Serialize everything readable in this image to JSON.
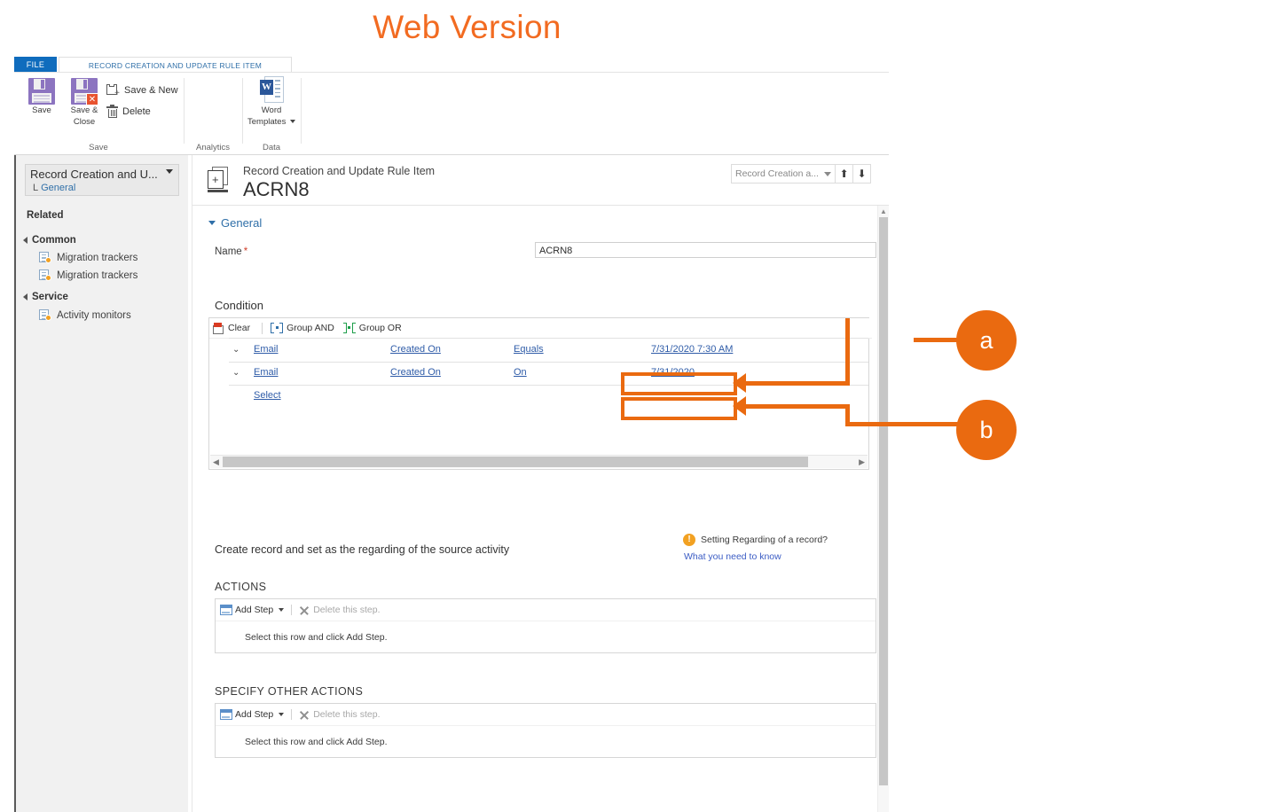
{
  "slide": {
    "title": "Web Version"
  },
  "ribbon": {
    "tabs": [
      {
        "label": "FILE",
        "name": "tab-file"
      },
      {
        "label": "RECORD CREATION AND UPDATE RULE ITEM",
        "name": "tab-record-creation-and-update-rule-item"
      }
    ],
    "buttons": {
      "save": "Save",
      "save_close_line1": "Save &",
      "save_close_line2": "Close",
      "save_new": "Save & New",
      "delete": "Delete",
      "word_templates_line1": "Word",
      "word_templates_line2": "Templates"
    },
    "group_labels": {
      "save": "Save",
      "analytics": "Analytics",
      "data": "Data"
    }
  },
  "sidebar": {
    "selector": {
      "title": "Record Creation and U...",
      "sub_prefix": "L",
      "sub_label": "General"
    },
    "related_header": "Related",
    "groups": [
      {
        "label": "Common",
        "items": [
          "Migration trackers",
          "Migration trackers"
        ]
      },
      {
        "label": "Service",
        "items": [
          "Activity monitors"
        ]
      }
    ]
  },
  "form": {
    "entity_label": "Record Creation and Update Rule Item",
    "record_title": "ACRN8",
    "form_selector": "Record Creation a...",
    "section_general": "General",
    "name_field": {
      "label": "Name",
      "required_mark": "*",
      "value": "ACRN8"
    },
    "condition_label": "Condition",
    "grid_toolbar": {
      "clear": "Clear",
      "group_and": "Group AND",
      "group_or": "Group OR"
    },
    "condition_rows": [
      {
        "entity": "Email",
        "field": "Created On",
        "operator": "Equals",
        "value": "7/31/2020 7:30 AM"
      },
      {
        "entity": "Email",
        "field": "Created On",
        "operator": "On",
        "value": "7/31/2020"
      }
    ],
    "select_row": "Select",
    "create_record_text": "Create record and set as the regarding of the source activity",
    "info": {
      "question": "Setting Regarding of a record?",
      "link": "What you need to know"
    },
    "actions_header": "ACTIONS",
    "other_actions_header": "SPECIFY OTHER ACTIONS",
    "step_toolbar": {
      "add_step": "Add Step",
      "delete_step": "Delete this step."
    },
    "step_hint": "Select this row and click Add Step."
  },
  "annotations": {
    "callouts": [
      {
        "id": "a",
        "label": "a",
        "target": "7/31/2020 7:30 AM"
      },
      {
        "id": "b",
        "label": "b",
        "target": "7/31/2020"
      }
    ],
    "accent_color": "#EA6A10"
  }
}
